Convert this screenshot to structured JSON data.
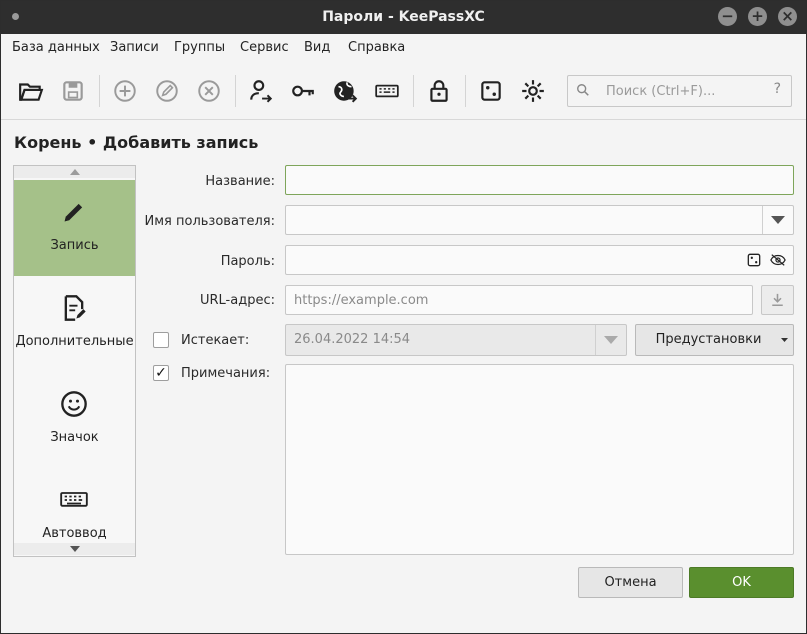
{
  "window": {
    "title": "Пароли - KeePassXC"
  },
  "menu": [
    "База данных",
    "Записи",
    "Группы",
    "Сервис",
    "Вид",
    "Справка"
  ],
  "toolbar": {
    "icons": [
      "open-database-icon",
      "save-database-icon",
      "add-entry-icon",
      "edit-entry-icon",
      "delete-entry-icon",
      "copy-username-icon",
      "copy-password-icon",
      "copy-url-icon",
      "autotype-icon",
      "lock-database-icon",
      "password-generator-icon",
      "settings-icon"
    ],
    "search_placeholder": "Поиск (Ctrl+F)...",
    "search_help": "?"
  },
  "page": {
    "heading": "Корень • Добавить запись"
  },
  "sidebar": {
    "items": [
      {
        "label": "Запись",
        "icon": "pencil-icon",
        "active": true
      },
      {
        "label": "Дополнительные",
        "icon": "document-edit-icon",
        "active": false
      },
      {
        "label": "Значок",
        "icon": "smiley-icon",
        "active": false
      },
      {
        "label": "Автоввод",
        "icon": "keyboard-icon",
        "active": false
      }
    ]
  },
  "form": {
    "title_label": "Название:",
    "title_value": "",
    "username_label": "Имя пользователя:",
    "username_value": "",
    "password_label": "Пароль:",
    "password_value": "",
    "url_label": "URL-адрес:",
    "url_placeholder": "https://example.com",
    "expires_label": "Истекает:",
    "expires_checked": false,
    "expires_value": "26.04.2022 14:54",
    "presets_label": "Предустановки",
    "notes_label": "Примечания:",
    "notes_checked": true,
    "notes_check_glyph": "✓",
    "notes_value": ""
  },
  "buttons": {
    "cancel": "Отмена",
    "ok": "OK"
  },
  "colors": {
    "active_tab": "#a5c189",
    "ok_button": "#5a8f2e",
    "titlebar": "#2e2e2e",
    "focus_border": "#7ea55a"
  }
}
